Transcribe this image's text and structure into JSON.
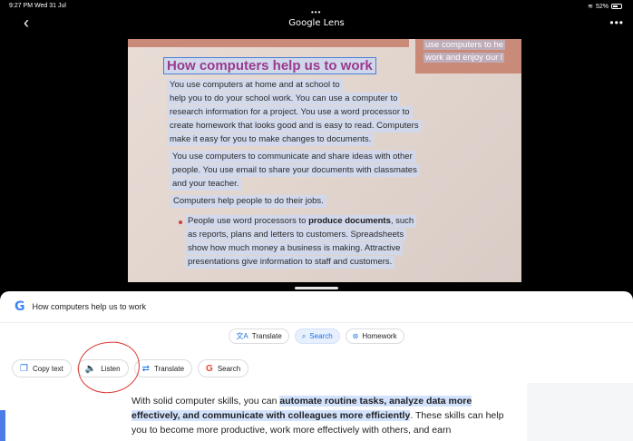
{
  "status_bar": {
    "time": "9:27 PM  Wed 31 Jul",
    "battery": "52%"
  },
  "nav": {
    "back_icon": "‹",
    "grabber": "•••",
    "title": "Google Lens",
    "more": "•••"
  },
  "photo": {
    "title": "How computers help us to work",
    "side_lines": [
      "use computers to he",
      "work and enjoy our l"
    ],
    "para1": [
      "You use computers at home and at school to",
      "help you to do your school work. You can use a computer to",
      "research information for a project. You use a word processor to",
      "create homework that looks good and is easy to read. Computers",
      "make it easy for you to make changes to documents."
    ],
    "para2": [
      "You use computers to communicate and share ideas with other",
      "people. You use email to share your documents with classmates",
      "and your teacher."
    ],
    "para3": "Computers help people to do their jobs.",
    "bullet": {
      "pre": "People use word processors to ",
      "bold": "produce documents",
      "post": ", such",
      "lines": [
        "as reports, plans and letters to customers. Spreadsheets",
        "show how much money a business is making. Attractive",
        "presentations give information to staff and customers."
      ]
    }
  },
  "sheet": {
    "query": "How computers help us to work",
    "chips": [
      {
        "icon": "文A",
        "label": "Translate",
        "active": false
      },
      {
        "icon": "⌕",
        "label": "Search",
        "active": true
      },
      {
        "icon": "⊛",
        "label": "Homework",
        "active": false
      }
    ],
    "actions": [
      {
        "icon": "❐",
        "label": "Copy text"
      },
      {
        "icon": "🔈",
        "label": "Listen"
      },
      {
        "icon": "⇄",
        "label": "Translate"
      },
      {
        "icon": "G",
        "label": "Search"
      }
    ],
    "result": {
      "pre": "With solid computer skills, you can ",
      "hl1": "automate routine tasks, analyze data more effectively, and communicate with colleagues more efficiently",
      "mid": ". These skills can help you to become more productive, work more effectively with others, and earn"
    }
  },
  "colors": {
    "accent": "#1a73e8",
    "title_purple": "#9a3a8e",
    "annotation_red": "#d9352e"
  }
}
